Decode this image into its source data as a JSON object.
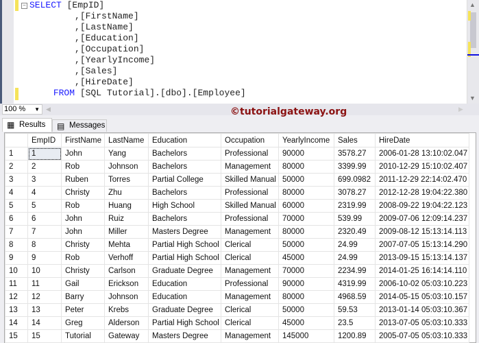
{
  "editor": {
    "lines": [
      {
        "kw": "SELECT",
        "rest": " [EmpID]"
      },
      {
        "kw": "",
        "rest": "      ,[FirstName]"
      },
      {
        "kw": "",
        "rest": "      ,[LastName]"
      },
      {
        "kw": "",
        "rest": "      ,[Education]"
      },
      {
        "kw": "",
        "rest": "      ,[Occupation]"
      },
      {
        "kw": "",
        "rest": "      ,[YearlyIncome]"
      },
      {
        "kw": "",
        "rest": "      ,[Sales]"
      },
      {
        "kw": "",
        "rest": "      ,[HireDate]"
      },
      {
        "kw": "  FROM",
        "rest": " [SQL Tutorial].[dbo].[Employee]"
      }
    ]
  },
  "zoom": "100 %",
  "watermark": "©tutorialgateway.org",
  "tabs": {
    "results": "Results",
    "messages": "Messages"
  },
  "grid": {
    "columns": [
      "EmpID",
      "FirstName",
      "LastName",
      "Education",
      "Occupation",
      "YearlyIncome",
      "Sales",
      "HireDate"
    ],
    "rows": [
      [
        "1",
        "John",
        "Yang",
        "Bachelors",
        "Professional",
        "90000",
        "3578.27",
        "2006-01-28 13:10:02.047"
      ],
      [
        "2",
        "Rob",
        "Johnson",
        "Bachelors",
        "Management",
        "80000",
        "3399.99",
        "2010-12-29 15:10:02.407"
      ],
      [
        "3",
        "Ruben",
        "Torres",
        "Partial College",
        "Skilled Manual",
        "50000",
        "699.0982",
        "2011-12-29 22:14:02.470"
      ],
      [
        "4",
        "Christy",
        "Zhu",
        "Bachelors",
        "Professional",
        "80000",
        "3078.27",
        "2012-12-28 19:04:22.380"
      ],
      [
        "5",
        "Rob",
        "Huang",
        "High School",
        "Skilled Manual",
        "60000",
        "2319.99",
        "2008-09-22 19:04:22.123"
      ],
      [
        "6",
        "John",
        "Ruiz",
        "Bachelors",
        "Professional",
        "70000",
        "539.99",
        "2009-07-06 12:09:14.237"
      ],
      [
        "7",
        "John",
        "Miller",
        "Masters Degree",
        "Management",
        "80000",
        "2320.49",
        "2009-08-12 15:13:14.113"
      ],
      [
        "8",
        "Christy",
        "Mehta",
        "Partial High School",
        "Clerical",
        "50000",
        "24.99",
        "2007-07-05 15:13:14.290"
      ],
      [
        "9",
        "Rob",
        "Verhoff",
        "Partial High School",
        "Clerical",
        "45000",
        "24.99",
        "2013-09-15 15:13:14.137"
      ],
      [
        "10",
        "Christy",
        "Carlson",
        "Graduate Degree",
        "Management",
        "70000",
        "2234.99",
        "2014-01-25 16:14:14.110"
      ],
      [
        "11",
        "Gail",
        "Erickson",
        "Education",
        "Professional",
        "90000",
        "4319.99",
        "2006-10-02 05:03:10.223"
      ],
      [
        "12",
        "Barry",
        "Johnson",
        "Education",
        "Management",
        "80000",
        "4968.59",
        "2014-05-15 05:03:10.157"
      ],
      [
        "13",
        "Peter",
        "Krebs",
        "Graduate Degree",
        "Clerical",
        "50000",
        "59.53",
        "2013-01-14 05:03:10.367"
      ],
      [
        "14",
        "Greg",
        "Alderson",
        "Partial High School",
        "Clerical",
        "45000",
        "23.5",
        "2013-07-05 05:03:10.333"
      ],
      [
        "15",
        "Tutorial",
        "Gateway",
        "Masters Degree",
        "Management",
        "145000",
        "1200.89",
        "2005-07-05 05:03:10.333"
      ]
    ]
  }
}
